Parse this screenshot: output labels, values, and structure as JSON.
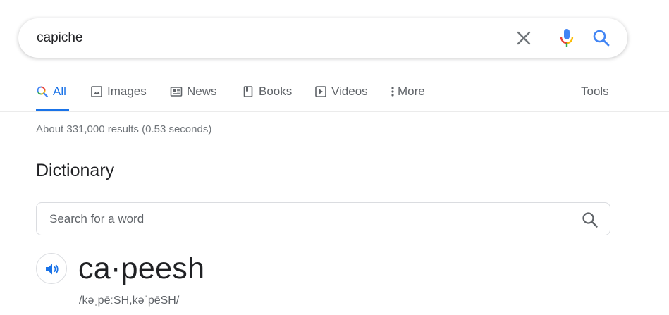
{
  "search": {
    "query": "capiche",
    "clear_icon": "close-icon",
    "mic_icon": "microphone-icon",
    "search_icon": "search-icon"
  },
  "tabs": [
    {
      "label": "All",
      "icon": "search-icon",
      "active": true
    },
    {
      "label": "Images",
      "icon": "image-icon",
      "active": false
    },
    {
      "label": "News",
      "icon": "newspaper-icon",
      "active": false
    },
    {
      "label": "Books",
      "icon": "book-icon",
      "active": false
    },
    {
      "label": "Videos",
      "icon": "play-icon",
      "active": false
    },
    {
      "label": "More",
      "icon": "vertical-dots-icon",
      "active": false
    },
    {
      "label": "Tools",
      "active": false
    }
  ],
  "results_stats": "About 331,000 results (0.53 seconds)",
  "dictionary": {
    "title": "Dictionary",
    "search_placeholder": "Search for a word",
    "headword": "ca·peesh",
    "pronunciation": "/kəˌpēːSH,kəˈpēSH/"
  },
  "colors": {
    "accent": "#1a73e8",
    "text": "#202124",
    "muted": "#5f6368",
    "stats": "#70757a",
    "google_blue": "#4285f4",
    "google_red": "#ea4335",
    "google_yellow": "#fbbc05",
    "google_green": "#34a853"
  }
}
